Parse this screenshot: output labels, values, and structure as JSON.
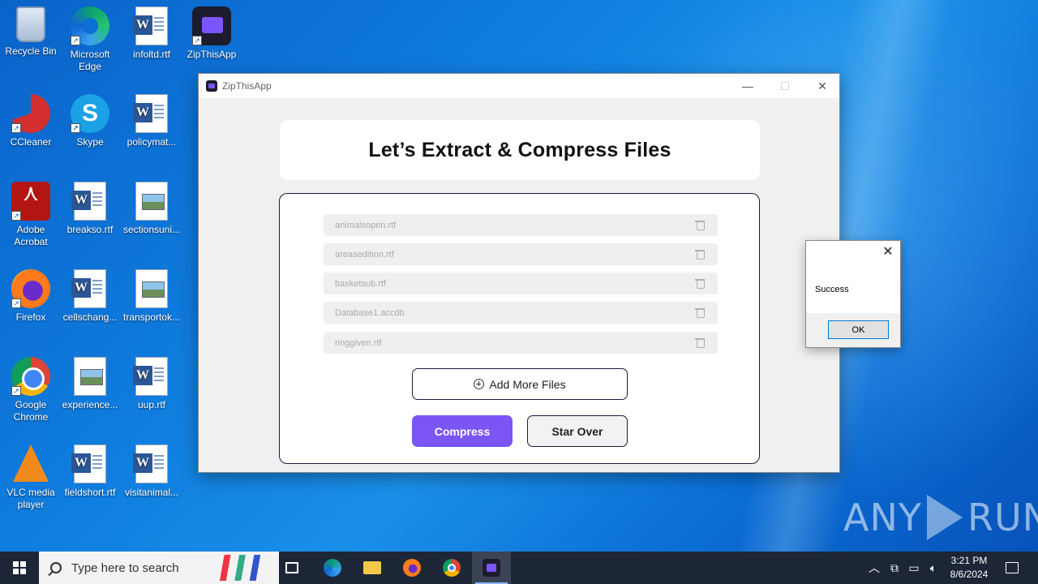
{
  "desktop": {
    "icons": [
      {
        "label": "Recycle Bin",
        "icon": "recycle-bin-icon"
      },
      {
        "label": "Microsoft Edge",
        "icon": "edge-icon"
      },
      {
        "label": "infoltd.rtf",
        "icon": "word-document-icon"
      },
      {
        "label": "ZipThisApp",
        "icon": "zipthisapp-icon"
      },
      {
        "label": "CCleaner",
        "icon": "ccleaner-icon"
      },
      {
        "label": "Skype",
        "icon": "skype-icon"
      },
      {
        "label": "policymat...",
        "icon": "word-document-icon"
      },
      {
        "label": "Adobe Acrobat",
        "icon": "acrobat-icon"
      },
      {
        "label": "breakso.rtf",
        "icon": "word-document-icon"
      },
      {
        "label": "sectionsuni...",
        "icon": "image-file-icon"
      },
      {
        "label": "Firefox",
        "icon": "firefox-icon"
      },
      {
        "label": "cellschang...",
        "icon": "word-document-icon"
      },
      {
        "label": "transportok...",
        "icon": "image-file-icon"
      },
      {
        "label": "Google Chrome",
        "icon": "chrome-icon"
      },
      {
        "label": "experience...",
        "icon": "image-file-icon"
      },
      {
        "label": "uup.rtf",
        "icon": "word-document-icon"
      },
      {
        "label": "VLC media player",
        "icon": "vlc-icon"
      },
      {
        "label": "fieldshort.rtf",
        "icon": "word-document-icon"
      },
      {
        "label": "visitanimal...",
        "icon": "word-document-icon"
      }
    ]
  },
  "window": {
    "title": "ZipThisApp",
    "min_glyph": "—",
    "max_glyph": "☐",
    "close_glyph": "✕",
    "heading": "Let’s Extract & Compress Files",
    "files": [
      {
        "name": "animalsopen.rtf"
      },
      {
        "name": "areasedition.rtf"
      },
      {
        "name": "basketsub.rtf"
      },
      {
        "name": "Database1.accdb"
      },
      {
        "name": "ringgiven.rtf"
      }
    ],
    "add_files_label": "Add More Files",
    "compress_label": "Compress",
    "start_over_label": "Star Over"
  },
  "message_box": {
    "text": "Success",
    "ok_label": "OK",
    "close_glyph": "✕"
  },
  "watermark": {
    "left": "ANY",
    "right": "RUN"
  },
  "taskbar": {
    "search_placeholder": "Type here to search",
    "pinned": [
      "task-view",
      "edge",
      "file-explorer",
      "firefox",
      "chrome",
      "zipthisapp"
    ],
    "active": "zipthisapp",
    "tray_chevron": "︿",
    "time": "3:21 PM",
    "date": "8/6/2024"
  }
}
